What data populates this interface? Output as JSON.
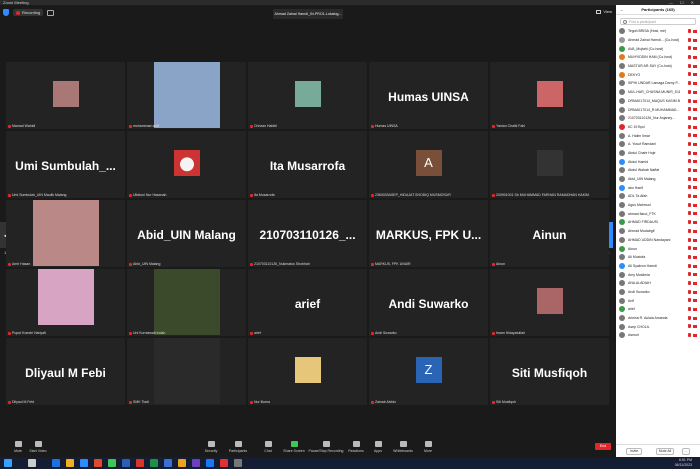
{
  "window": {
    "title": "Zoom Meeting",
    "controls": "—  ☐  ✕"
  },
  "header": {
    "recording_label": "Recording",
    "speaker_label": "Ahmad Zainal Hamdi_IN-PRO1-Lokalog...",
    "view_label": "View"
  },
  "pager": {
    "left": "1/4",
    "right": "1/4",
    "prev": "◀",
    "next": "▶"
  },
  "tiles": [
    {
      "name": "Mamad Wahidi",
      "big": ""
    },
    {
      "name": "mohammad aniff",
      "big": ""
    },
    {
      "name": "Chrizan Habibi",
      "big": ""
    },
    {
      "name": "Humas UINSA",
      "big": "Humas UINSA"
    },
    {
      "name": "Yanian Chalik Fahi",
      "big": ""
    },
    {
      "name": "Umi Sumbulah_UIN Maulik Malang",
      "big": "Umi  Sumbulah_..."
    },
    {
      "name": "Ulfatuni Nur Hasanah",
      "big": ""
    },
    {
      "name": "Ita Musarrofa",
      "big": "Ita Musarrofa"
    },
    {
      "name": "2360003ASEP_HIDAJAT SHODIQ MUSMOSUR",
      "big": ""
    },
    {
      "name": "200901001 Sb MUHAMMAD FARHAN RAMADHAN HAKIM",
      "big": ""
    },
    {
      "name": "Amir Hasan",
      "big": ""
    },
    {
      "name": "Abid_UIN Malang",
      "big": "Abid_UIN Malang"
    },
    {
      "name": "210703110126_Nukmatus Shobhah",
      "big": "210703110126_..."
    },
    {
      "name": "MARKUS, FPK UNAIR",
      "big": "MARKUS,  FPK  U..."
    },
    {
      "name": "Ainun",
      "big": "Ainun"
    },
    {
      "name": "Puput Koestri Hariyati",
      "big": ""
    },
    {
      "name": "Uni Kurniawati Indah",
      "big": ""
    },
    {
      "name": "arief",
      "big": "arief"
    },
    {
      "name": "Andi Suwarko",
      "big": "Andi Suwarko"
    },
    {
      "name": "Imam Hidayatullah",
      "big": ""
    },
    {
      "name": "Dliyaul M Febi",
      "big": "Dliyaul M Febi"
    },
    {
      "name": "SMK Tiadi",
      "big": ""
    },
    {
      "name": "Nur Burna",
      "big": ""
    },
    {
      "name": "Zainab Alvido",
      "big": ""
    },
    {
      "name": "Siti Musfiqoh",
      "big": "Siti Musfiqoh"
    }
  ],
  "tile_avatars": {
    "ita_letter": "A",
    "andi_letter": "Z"
  },
  "toolbar": {
    "mute": "Mute",
    "stop_video": "Start Video",
    "security": "Security",
    "participants": "Participants",
    "participants_count": "165",
    "chat": "Chat",
    "share": "Share Screen",
    "record": "Pause/Stop Recording",
    "reactions": "Reactions",
    "apps": "Apps",
    "whiteboards": "Whiteboards",
    "more": "More",
    "end": "End"
  },
  "panel": {
    "title": "Participants (165)",
    "collapse": "⌄",
    "search_placeholder": "Find a participant",
    "invite": "Invite",
    "mute_all": "Mute All",
    "more": "..."
  },
  "participants": [
    {
      "name": "Teguh BRISA (Host, me)",
      "color": "#777"
    },
    {
      "name": "Ahmad Zainal Hamdi... (Co-host)",
      "color": "#999"
    },
    {
      "name": "AVA_Mujtahi (Co-host)",
      "color": "#3a9a4a"
    },
    {
      "name": "MUHYIDDIN HAM (Co-host)",
      "color": "#e07a1f"
    },
    {
      "name": "MASTUR AR-SAY (Co-host)",
      "color": "#777"
    },
    {
      "name": "DEKYO",
      "color": "#e07a1f"
    },
    {
      "name": "SIPHI UNDAR Lamaga Darny P...",
      "color": "#777"
    },
    {
      "name": "MUL.HAR_CHUSNA MUNIR_S11...",
      "color": "#777"
    },
    {
      "name": "DRMA017014_MAQUS KASIM B...",
      "color": "#777"
    },
    {
      "name": "DRMA017014_R.MUHAMMAD...",
      "color": "#777"
    },
    {
      "name": "210703110126_Nur Anjaney...",
      "color": "#777"
    },
    {
      "name": "6C 19 Bpd",
      "color": "#e02828"
    },
    {
      "name": "A. Halim Ilmar",
      "color": "#777"
    },
    {
      "name": "A. Yusuf Ramdani",
      "color": "#777"
    },
    {
      "name": "Abdul Chafe Huje",
      "color": "#777"
    },
    {
      "name": "Abdul Hamid",
      "color": "#2d8cff"
    },
    {
      "name": "Abdul Wahab Naffat",
      "color": "#777"
    },
    {
      "name": "Abid_UIN Malang",
      "color": "#777"
    },
    {
      "name": "abu Hanif",
      "color": "#2d8cff"
    },
    {
      "name": "ADL Ta Afah",
      "color": "#777"
    },
    {
      "name": "Agus Mahmud",
      "color": "#777"
    },
    {
      "name": "ahmad fiaud_FTK",
      "color": "#777"
    },
    {
      "name": "AHMAD FIRDAUSI",
      "color": "#3a9a4a"
    },
    {
      "name": "Ahmad Mudabgif",
      "color": "#777"
    },
    {
      "name": "AHMAD UDDIN Nandayani",
      "color": "#777"
    },
    {
      "name": "Ainun",
      "color": "#3a9a4a"
    },
    {
      "name": "Ali Mustofa",
      "color": "#777"
    },
    {
      "name": "Ali Syakron Hamdi",
      "color": "#2d8cff"
    },
    {
      "name": "Amy Muslimia",
      "color": "#777"
    },
    {
      "name": "ANA ALADIAH",
      "color": "#777"
    },
    {
      "name": "Andi Suwarko",
      "color": "#777"
    },
    {
      "name": "Anif",
      "color": "#777"
    },
    {
      "name": "arief",
      "color": "#3a9a4a"
    },
    {
      "name": "Arinisa R. Aulaia Amanda",
      "color": "#777"
    },
    {
      "name": "Asep CHOLIL",
      "color": "#777"
    },
    {
      "name": "Asmuri",
      "color": "#777"
    }
  ],
  "clock": {
    "time": "6:51 PM",
    "date": "06/11/2023"
  }
}
